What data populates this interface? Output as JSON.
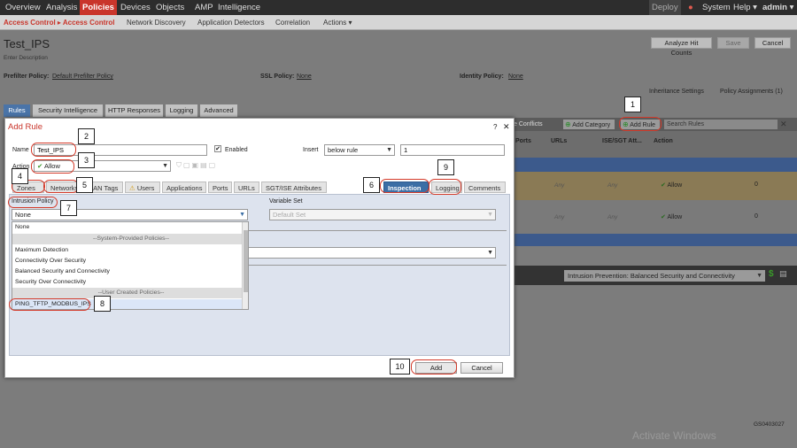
{
  "topnav": {
    "items": [
      "Overview",
      "Analysis",
      "Policies",
      "Devices",
      "Objects",
      "AMP",
      "Intelligence"
    ],
    "right": {
      "deploy": "Deploy",
      "system": "System",
      "help": "Help ▾",
      "user": "admin ▾"
    }
  },
  "subnav": {
    "items": [
      "Access Control ▸ Access Control",
      "Network Discovery",
      "Application Detectors",
      "Correlation",
      "Actions ▾"
    ]
  },
  "policy": {
    "name": "Test_IPS",
    "description_placeholder": "Enter Description",
    "buttons": {
      "analyze": "Analyze Hit Counts",
      "save": "Save",
      "cancel": "Cancel"
    },
    "prefilter_label": "Prefilter Policy:",
    "prefilter_value": "Default Prefilter Policy",
    "ssl_label": "SSL Policy:",
    "ssl_value": "None",
    "identity_label": "Identity Policy:",
    "identity_value": "None",
    "inheritance": "Inheritance Settings",
    "assignments": "Policy Assignments (1)"
  },
  "page_tabs": [
    "Rules",
    "Security Intelligence",
    "HTTP Responses",
    "Logging",
    "Advanced"
  ],
  "rules_toolbar": {
    "conflicts": "e Conflicts",
    "add_category": "Add Category",
    "add_rule": "Add Rule",
    "search_placeholder": "Search Rules"
  },
  "rules_table": {
    "headers": [
      "Ports",
      "URLs",
      "ISE/SGT Att...",
      "Action"
    ],
    "rows": [
      {
        "urls": "Any",
        "ise": "Any",
        "action": "Allow",
        "count": "0"
      },
      {
        "urls": "Any",
        "ise": "Any",
        "action": "Allow",
        "count": "0"
      }
    ],
    "intrusion_prevention": "Intrusion Prevention: Balanced Security and Connectivity"
  },
  "dialog": {
    "title": "Add Rule",
    "help": "?",
    "close": "✕",
    "name_label": "Name",
    "name_value": "Test_IPS",
    "enabled_label": "Enabled",
    "insert_label": "Insert",
    "insert_value": "below rule",
    "insert_index": "1",
    "action_label": "Action",
    "action_value": "Allow",
    "tabs": [
      "Zones",
      "Networks",
      "VLAN Tags",
      "Users",
      "Applications",
      "Ports",
      "URLs",
      "SGT/ISE Attributes",
      "Inspection",
      "Logging",
      "Comments"
    ],
    "intrusion_policy_label": "Intrusion Policy",
    "intrusion_policy_value": "None",
    "variable_set_label": "Variable Set",
    "variable_set_value": "Default Set",
    "dropdown_options": [
      {
        "text": "None",
        "group": false
      },
      {
        "text": "--System-Provided Policies--",
        "group": true
      },
      {
        "text": "Maximum Detection",
        "group": false
      },
      {
        "text": "Connectivity Over Security",
        "group": false
      },
      {
        "text": "Balanced Security and Connectivity",
        "group": false
      },
      {
        "text": "Security Over Connectivity",
        "group": false
      },
      {
        "text": "--User Created Policies--",
        "group": true
      },
      {
        "text": "PING_TFTP_MODBUS_IPS",
        "group": false
      }
    ],
    "add_button": "Add",
    "cancel_button": "Cancel"
  },
  "callouts": [
    "1",
    "2",
    "3",
    "4",
    "5",
    "6",
    "7",
    "8",
    "9",
    "10"
  ],
  "watermark": "Activate Windows",
  "figure_id": "GS0403027",
  "colors": {
    "accent_red": "#c9352b",
    "callout_ring": "#d43a2a",
    "inspection_tab": "#3b6ea5",
    "allow_green": "#3a9a2a",
    "row_highlight": "#e7c98a",
    "selected_row": "#3e68b0"
  }
}
